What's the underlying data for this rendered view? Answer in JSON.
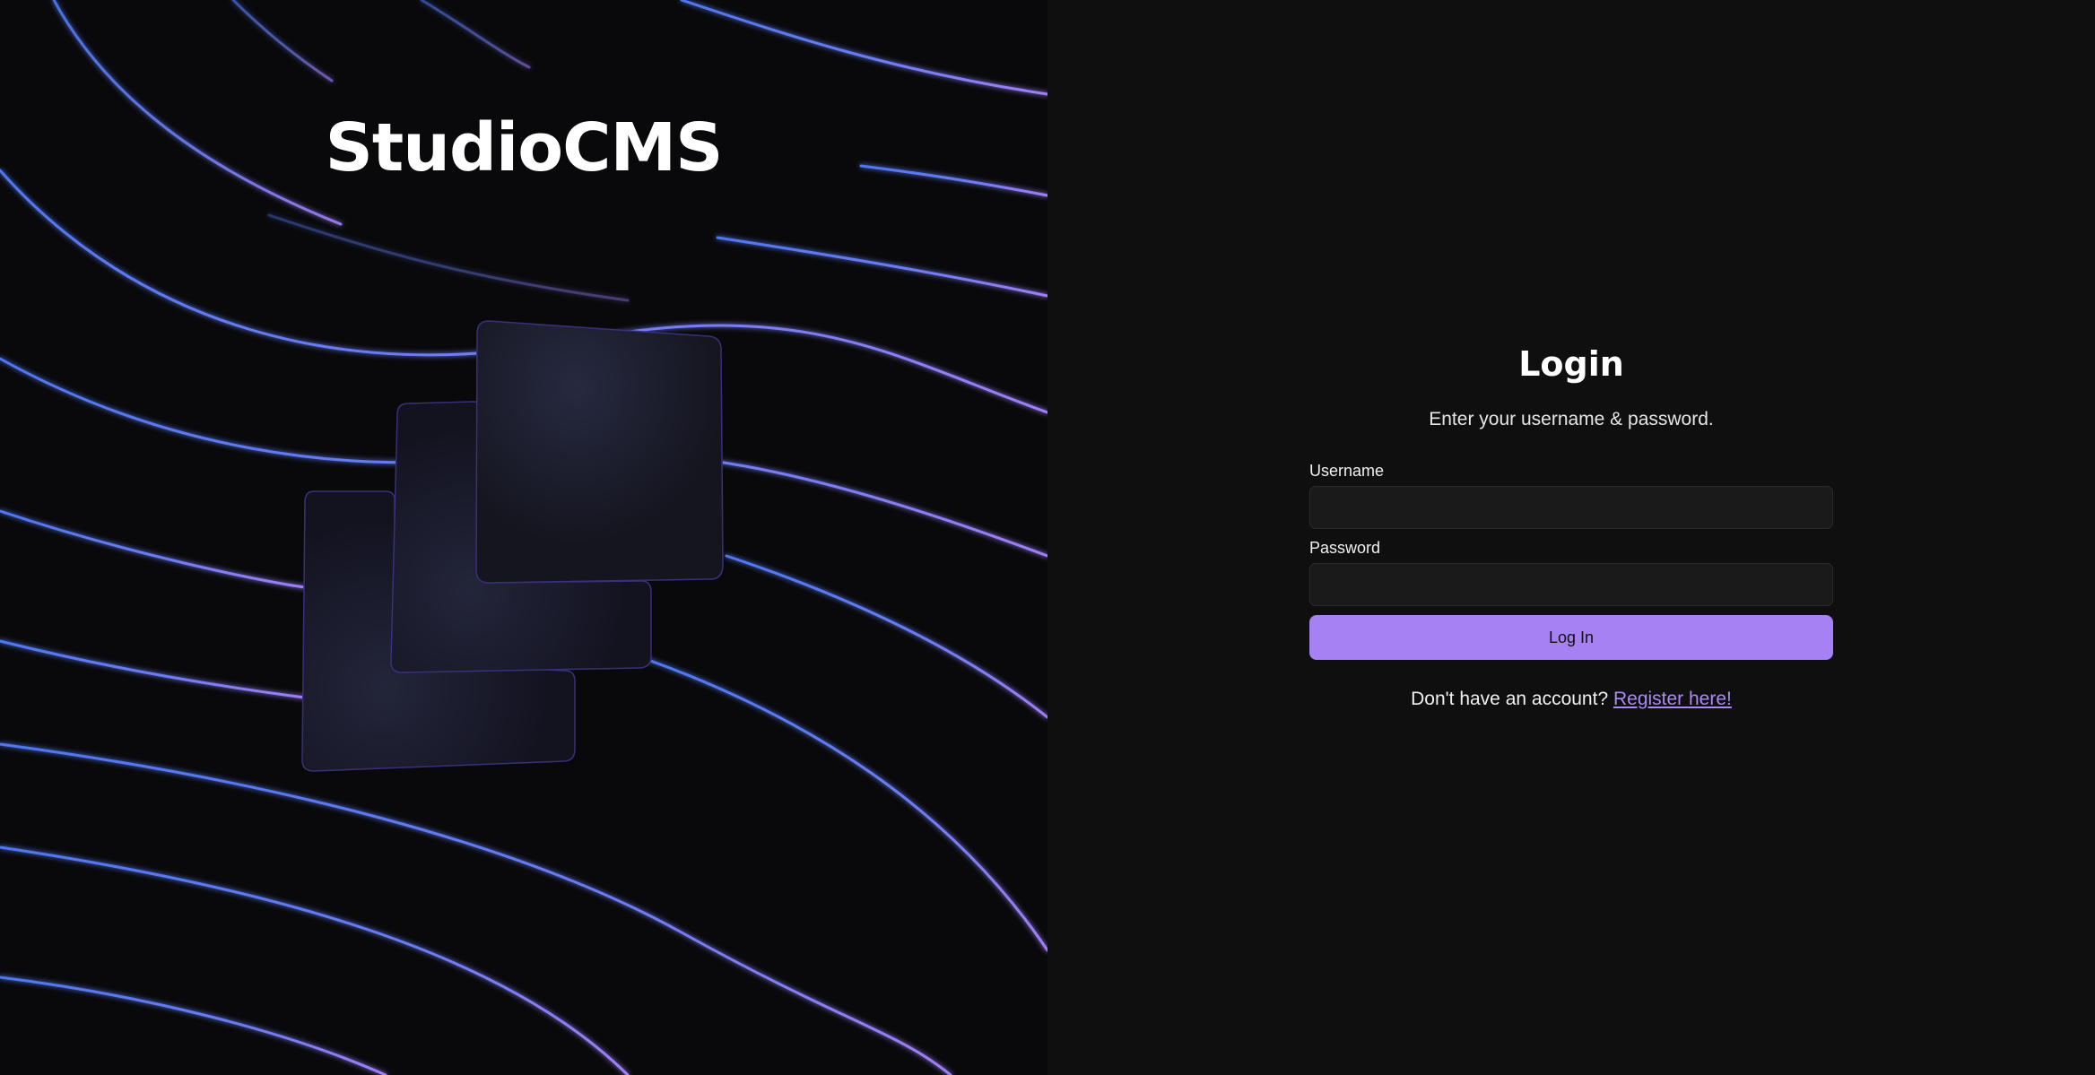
{
  "hero": {
    "brand_name": "StudioCMS",
    "logo_icon": "studiocms-stacked-cards-logo"
  },
  "login": {
    "title": "Login",
    "subtitle": "Enter your username & password.",
    "username_label": "Username",
    "username_value": "",
    "password_label": "Password",
    "password_value": "",
    "submit_label": "Log In",
    "register_prompt": "Don't have an account?",
    "register_link": "Register here!"
  },
  "colors": {
    "accent": "#a581f3",
    "link": "#a98af7",
    "wave_blue": "#5b7cf0",
    "wave_purple": "#9a7af5",
    "panel_bg": "#0f0f0f",
    "hero_bg": "#09090c"
  }
}
